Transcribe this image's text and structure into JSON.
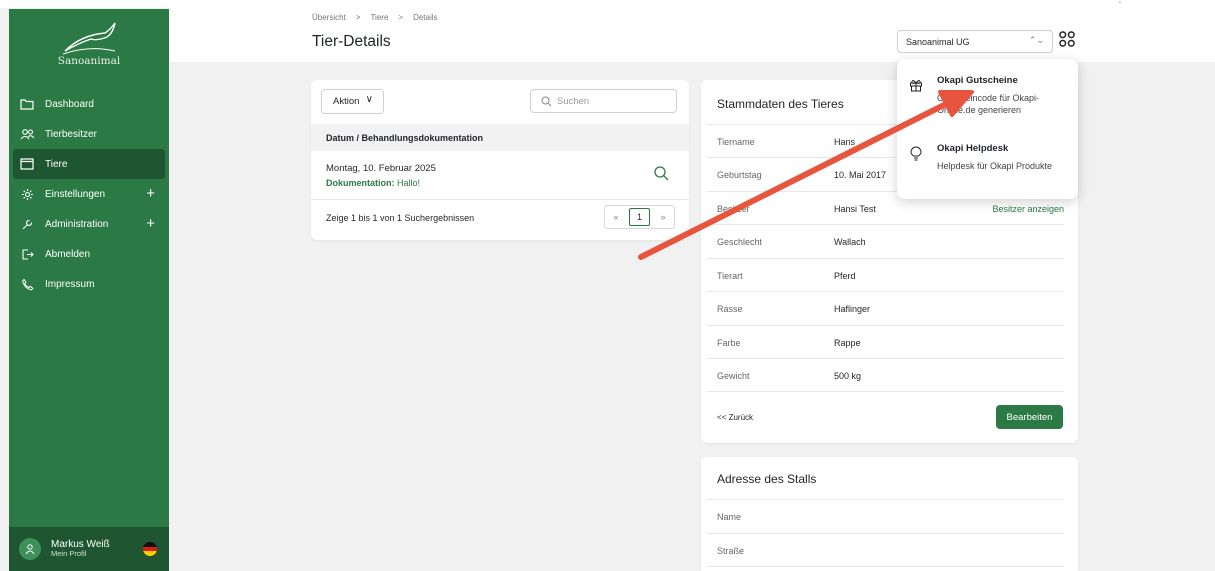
{
  "app": {
    "brand": "Sanoanimal"
  },
  "sidebar": {
    "items": [
      {
        "label": "Dashboard",
        "icon": "folder-icon"
      },
      {
        "label": "Tierbesitzer",
        "icon": "users-icon"
      },
      {
        "label": "Tiere",
        "icon": "folder-icon",
        "active": true
      },
      {
        "label": "Einstellungen",
        "icon": "settings-icon",
        "expand": "+"
      },
      {
        "label": "Administration",
        "icon": "wrench-icon",
        "expand": "+"
      },
      {
        "label": "Abmelden",
        "icon": "logout-icon"
      },
      {
        "label": "Impressum",
        "icon": "phone-icon"
      }
    ],
    "profile": {
      "name": "Markus Weiß",
      "subtitle": "Mein Profil"
    }
  },
  "header": {
    "breadcrumb": [
      "Übersicht",
      "Tiere",
      "Details"
    ],
    "title": "Tier-Details",
    "company_select": "Sanoanimal UG"
  },
  "list": {
    "action_button": "Aktion",
    "search_placeholder": "Suchen",
    "column": "Datum / Behandlungsdokumentation",
    "rows": [
      {
        "date": "Montag, 10. Februar 2025",
        "doc_label": "Dokumentation:",
        "doc_value": " Hallo!"
      }
    ],
    "results": "Zeige 1 bis 1 von 1 Suchergebnissen",
    "pager": {
      "prev": "«",
      "page": "1",
      "next": "»"
    }
  },
  "stammdaten": {
    "title": "Stammdaten des Tieres",
    "fields": [
      {
        "key": "Tiername",
        "value": "Hans"
      },
      {
        "key": "Geburtstag",
        "value": "10. Mai 2017"
      },
      {
        "key": "Besitzer",
        "value": "Hansi Test",
        "link": "Besitzer anzeigen"
      },
      {
        "key": "Geschlecht",
        "value": "Wallach"
      },
      {
        "key": "Tierart",
        "value": "Pferd"
      },
      {
        "key": "Rasse",
        "value": "Haflinger"
      },
      {
        "key": "Farbe",
        "value": "Rappe"
      },
      {
        "key": "Gewicht",
        "value": "500 kg"
      }
    ],
    "back": "<< Zurück",
    "edit": "Bearbeiten"
  },
  "stall": {
    "title": "Adresse des Stalls",
    "fields": [
      {
        "key": "Name"
      },
      {
        "key": "Straße"
      }
    ]
  },
  "apps_menu": {
    "items": [
      {
        "title": "Okapi Gutscheine",
        "subtitle": "Gutscheincode für Okapi-Online.de generieren",
        "icon": "gift-icon"
      },
      {
        "title": "Okapi Helpdesk",
        "subtitle": "Helpdesk für Okapi Produkte",
        "icon": "lightbulb-icon"
      }
    ]
  },
  "colors": {
    "sidebar": "#2b7a45",
    "sidebar_active": "#1e5631",
    "accent": "#2b7a45",
    "arrow": "#e8553f"
  }
}
